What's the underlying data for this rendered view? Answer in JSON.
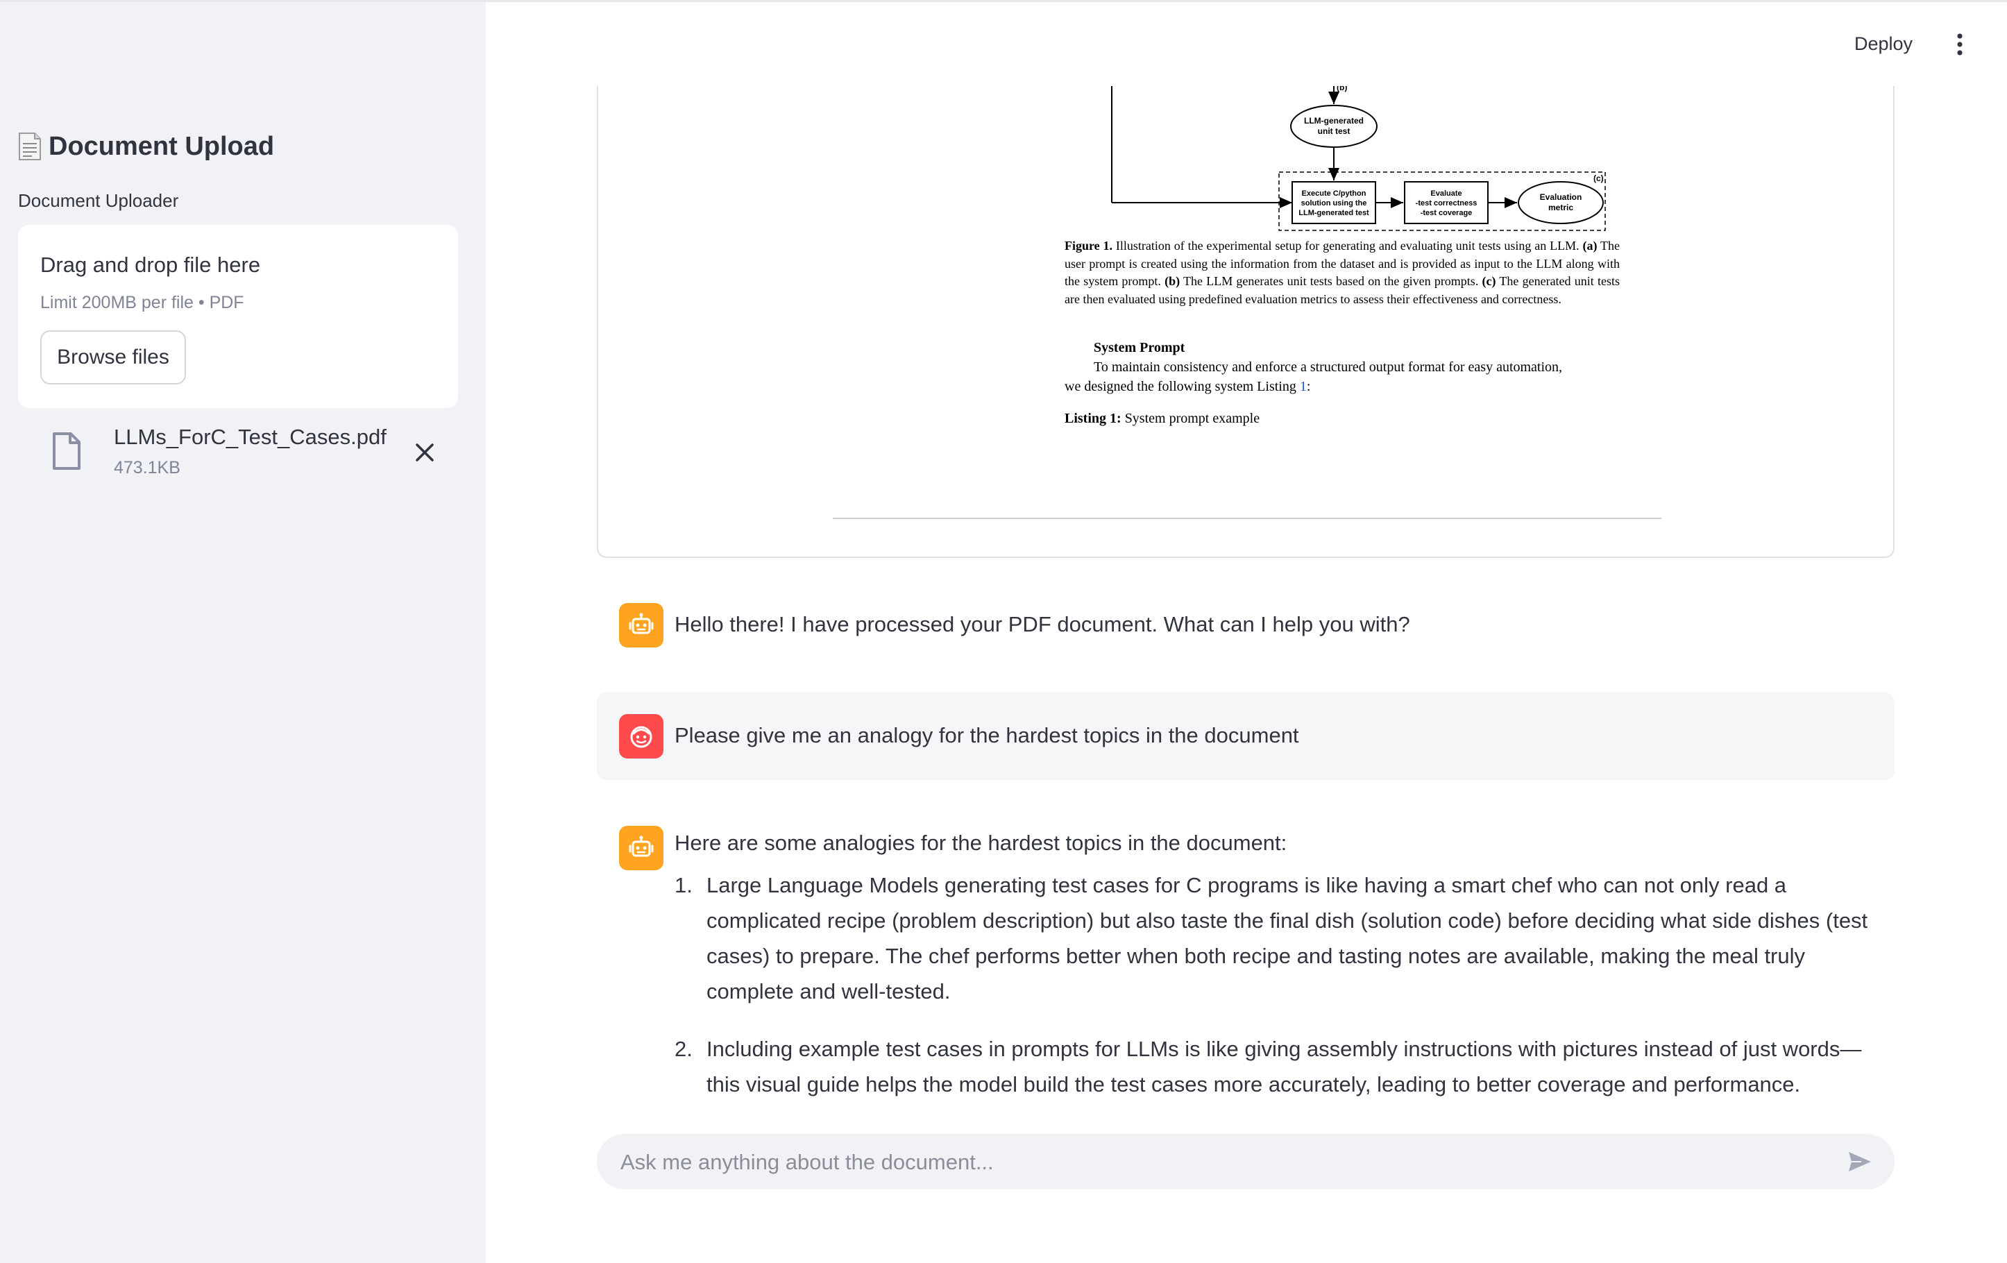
{
  "sidebar": {
    "title": "Document Upload",
    "title_icon": "page-facing-up-emoji",
    "uploader_label": "Document Uploader",
    "dropzone": {
      "title": "Drag and drop file here",
      "limit": "Limit 200MB per file • PDF",
      "browse_label": "Browse files"
    },
    "file": {
      "name": "LLMs_ForC_Test_Cases.pdf",
      "size": "473.1KB",
      "icon": "file-icon",
      "remove_icon": "close-icon"
    }
  },
  "header": {
    "deploy_label": "Deploy",
    "menu_icon": "kebab-menu-icon"
  },
  "pdf": {
    "diagram": {
      "edge_label_b": "(b)",
      "llm_node": [
        "LLM-generated",
        "unit test"
      ],
      "section_label_c": "(c)",
      "execute_box": [
        "Execute C/python",
        "solution using the",
        "LLM-generated test"
      ],
      "evaluate_box": [
        "Evaluate",
        "-test correctness",
        "-test coverage"
      ],
      "metric_node": [
        "Evaluation",
        "metric"
      ]
    },
    "caption": {
      "lead": "Figure 1.",
      "text1": " Illustration of the experimental setup for generating and evaluating unit tests using an LLM. ",
      "a": "(a)",
      "text2": " The user prompt is created using the information from the dataset and is provided as input to the LLM along with the system prompt. ",
      "b": "(b)",
      "text3": " The LLM generates unit tests based on the given prompts. ",
      "c": "(c)",
      "text4": " The generated unit tests are then evaluated using predefined evaluation metrics to assess their effectiveness and correctness."
    },
    "section_heading": "System Prompt",
    "para_line1": "To maintain consistency and enforce a structured output format for easy automation,",
    "para_line2": "we designed the following system Listing ",
    "para_link": "1",
    "para_end": ":",
    "listing_lead": "Listing 1:",
    "listing_text": " System prompt example"
  },
  "chat": {
    "messages": [
      {
        "role": "assistant",
        "avatar_icon": "robot-icon",
        "text": "Hello there! I have processed your PDF document. What can I help you with?"
      },
      {
        "role": "user",
        "avatar_icon": "smiley-face-icon",
        "text": "Please give me an analogy for the hardest topics in the document"
      },
      {
        "role": "assistant",
        "avatar_icon": "robot-icon",
        "text": "Here are some analogies for the hardest topics in the document:",
        "list": [
          {
            "num": "1.",
            "text": "Large Language Models generating test cases for C programs is like having a smart chef who can not only read a complicated recipe (problem description) but also taste the final dish (solution code) before deciding what side dishes (test cases) to prepare. The chef performs better when both recipe and tasting notes are available, making the meal truly complete and well-tested."
          },
          {
            "num": "2.",
            "text": "Including example test cases in prompts for LLMs is like giving assembly instructions with pictures instead of just words—this visual guide helps the model build the test cases more accurately, leading to better coverage and performance."
          }
        ]
      }
    ],
    "input_placeholder": "Ask me anything about the document...",
    "send_icon": "send-icon"
  },
  "colors": {
    "sidebar_bg": "#f0f2f6",
    "assistant_avatar": "#ffa421",
    "user_avatar": "#ff4b4b",
    "text": "#31333f",
    "muted_text": "#808495",
    "link": "#2458c8"
  }
}
